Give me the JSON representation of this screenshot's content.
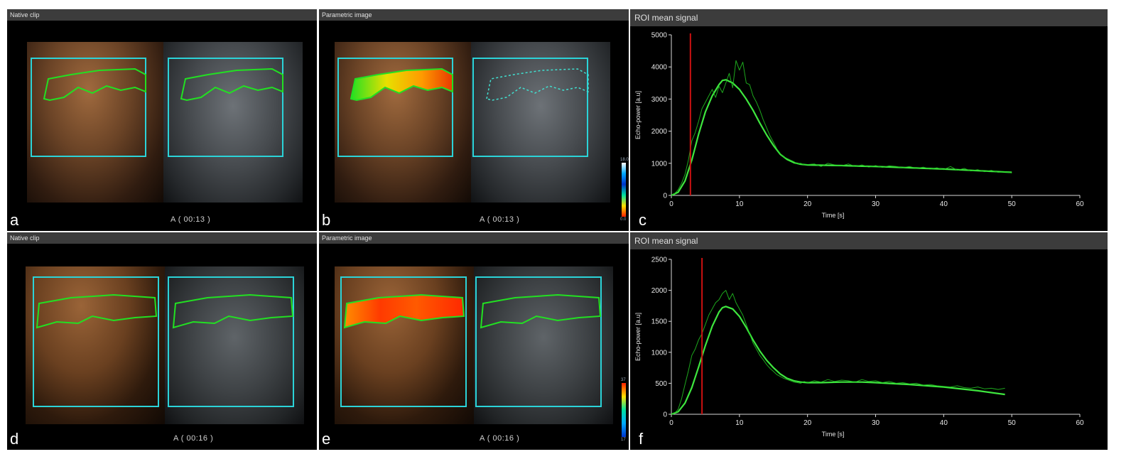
{
  "panels": {
    "a": {
      "title": "Native clip",
      "letter": "a",
      "caption": "A  ( 00:13 )"
    },
    "b": {
      "title": "Parametric image",
      "letter": "b",
      "caption": "A  ( 00:13 )",
      "cbar_top": "18.0",
      "cbar_bottom": "0.0"
    },
    "c": {
      "title": "ROI mean signal",
      "letter": "c"
    },
    "d": {
      "title": "Native clip",
      "letter": "d",
      "caption": "A  ( 00:16 )"
    },
    "e": {
      "title": "Parametric image",
      "letter": "e",
      "caption": "A  ( 00:16 )",
      "cbar_top": "37",
      "cbar_bottom": "17"
    },
    "f": {
      "title": "ROI mean signal",
      "letter": "f"
    }
  },
  "colors": {
    "roi_box": "#2bd3d8",
    "contour": "#22e022",
    "signal": "#22c422",
    "fit": "#3ee63e",
    "marker": "#cc1111"
  },
  "chart_data": [
    {
      "type": "line",
      "id": "c",
      "title": "ROI mean signal",
      "xlabel": "Time [s]",
      "ylabel": "Echo-power [a.u]",
      "xlim": [
        0,
        60
      ],
      "ylim": [
        0,
        5000
      ],
      "xticks": [
        0,
        10,
        20,
        30,
        40,
        50,
        60
      ],
      "yticks": [
        0,
        1000,
        2000,
        3000,
        4000,
        5000
      ],
      "marker_x": 2.8,
      "series": [
        {
          "kind": "fit",
          "x": [
            0,
            1,
            2,
            3,
            4,
            5,
            6,
            7,
            7.5,
            8,
            9,
            10,
            11,
            12,
            13,
            14,
            15,
            16,
            17,
            18,
            19,
            20,
            22,
            25,
            28,
            30,
            35,
            40,
            45,
            50
          ],
          "values": [
            0,
            100,
            450,
            1100,
            1900,
            2600,
            3100,
            3450,
            3580,
            3600,
            3500,
            3300,
            3000,
            2650,
            2250,
            1880,
            1550,
            1280,
            1120,
            1020,
            970,
            950,
            940,
            930,
            910,
            900,
            860,
            820,
            770,
            720
          ]
        },
        {
          "kind": "raw",
          "x": [
            0,
            0.5,
            1,
            1.5,
            2,
            2.5,
            3,
            3.5,
            4,
            4.5,
            5,
            5.5,
            6,
            6.5,
            7,
            7.5,
            8,
            8.5,
            9,
            9.5,
            10,
            10.5,
            11,
            11.5,
            12,
            12.5,
            13,
            13.5,
            14,
            14.5,
            15,
            15.5,
            16,
            16.5,
            17,
            17.5,
            18,
            18.5,
            19,
            19.5,
            20,
            21,
            22,
            23,
            24,
            25,
            26,
            27,
            28,
            29,
            30,
            31,
            32,
            33,
            34,
            35,
            36,
            37,
            38,
            39,
            40,
            41,
            42,
            43,
            44,
            45,
            46,
            47,
            48,
            49,
            50
          ],
          "values": [
            0,
            60,
            180,
            380,
            650,
            1100,
            1700,
            1950,
            2300,
            2700,
            2900,
            3100,
            3300,
            3050,
            3400,
            3200,
            3500,
            3800,
            3350,
            4200,
            3900,
            4150,
            3500,
            3450,
            3100,
            2900,
            2650,
            2350,
            2100,
            1850,
            1650,
            1450,
            1300,
            1200,
            1150,
            1100,
            1050,
            980,
            1000,
            950,
            960,
            980,
            900,
            1000,
            950,
            920,
            980,
            900,
            950,
            880,
            930,
            870,
            920,
            900,
            860,
            900,
            840,
            880,
            820,
            860,
            800,
            900,
            780,
            840,
            760,
            800,
            740,
            780,
            720,
            740,
            700
          ]
        }
      ]
    },
    {
      "type": "line",
      "id": "f",
      "title": "ROI mean signal",
      "xlabel": "Time [s]",
      "ylabel": "Echo-power [a.u]",
      "xlim": [
        0,
        60
      ],
      "ylim": [
        0,
        2500
      ],
      "xticks": [
        0,
        10,
        20,
        30,
        40,
        50,
        60
      ],
      "yticks": [
        0,
        500,
        1000,
        1500,
        2000,
        2500
      ],
      "marker_x": 4.5,
      "series": [
        {
          "kind": "fit",
          "x": [
            0,
            1,
            2,
            3,
            4,
            5,
            6,
            7,
            7.5,
            8,
            9,
            10,
            11,
            12,
            13,
            14,
            15,
            16,
            17,
            18,
            19,
            20,
            22,
            25,
            28,
            30,
            35,
            40,
            45,
            49
          ],
          "values": [
            0,
            40,
            180,
            430,
            760,
            1110,
            1420,
            1650,
            1720,
            1740,
            1700,
            1580,
            1400,
            1200,
            1020,
            870,
            750,
            650,
            580,
            540,
            520,
            510,
            510,
            520,
            520,
            510,
            480,
            440,
            380,
            320
          ]
        },
        {
          "kind": "raw",
          "x": [
            0,
            0.5,
            1,
            1.5,
            2,
            2.5,
            3,
            3.5,
            4,
            4.5,
            5,
            5.5,
            6,
            6.5,
            7,
            7.5,
            8,
            8.5,
            9,
            9.5,
            10,
            10.5,
            11,
            11.5,
            12,
            12.5,
            13,
            13.5,
            14,
            14.5,
            15,
            15.5,
            16,
            16.5,
            17,
            17.5,
            18,
            18.5,
            19,
            19.5,
            20,
            21,
            22,
            23,
            24,
            25,
            26,
            27,
            28,
            29,
            30,
            31,
            32,
            33,
            34,
            35,
            36,
            37,
            38,
            39,
            40,
            41,
            42,
            43,
            44,
            45,
            46,
            47,
            48,
            49
          ],
          "values": [
            0,
            20,
            80,
            250,
            480,
            700,
            950,
            1050,
            1200,
            1300,
            1450,
            1600,
            1700,
            1800,
            1850,
            1950,
            2000,
            1850,
            1950,
            1800,
            1700,
            1600,
            1450,
            1300,
            1150,
            1050,
            950,
            880,
            800,
            740,
            690,
            640,
            610,
            580,
            560,
            540,
            520,
            510,
            500,
            530,
            510,
            540,
            520,
            560,
            530,
            550,
            540,
            520,
            560,
            530,
            540,
            510,
            530,
            500,
            510,
            490,
            500,
            470,
            480,
            460,
            450,
            440,
            460,
            430,
            420,
            440,
            410,
            420,
            400,
            420
          ]
        }
      ]
    }
  ]
}
